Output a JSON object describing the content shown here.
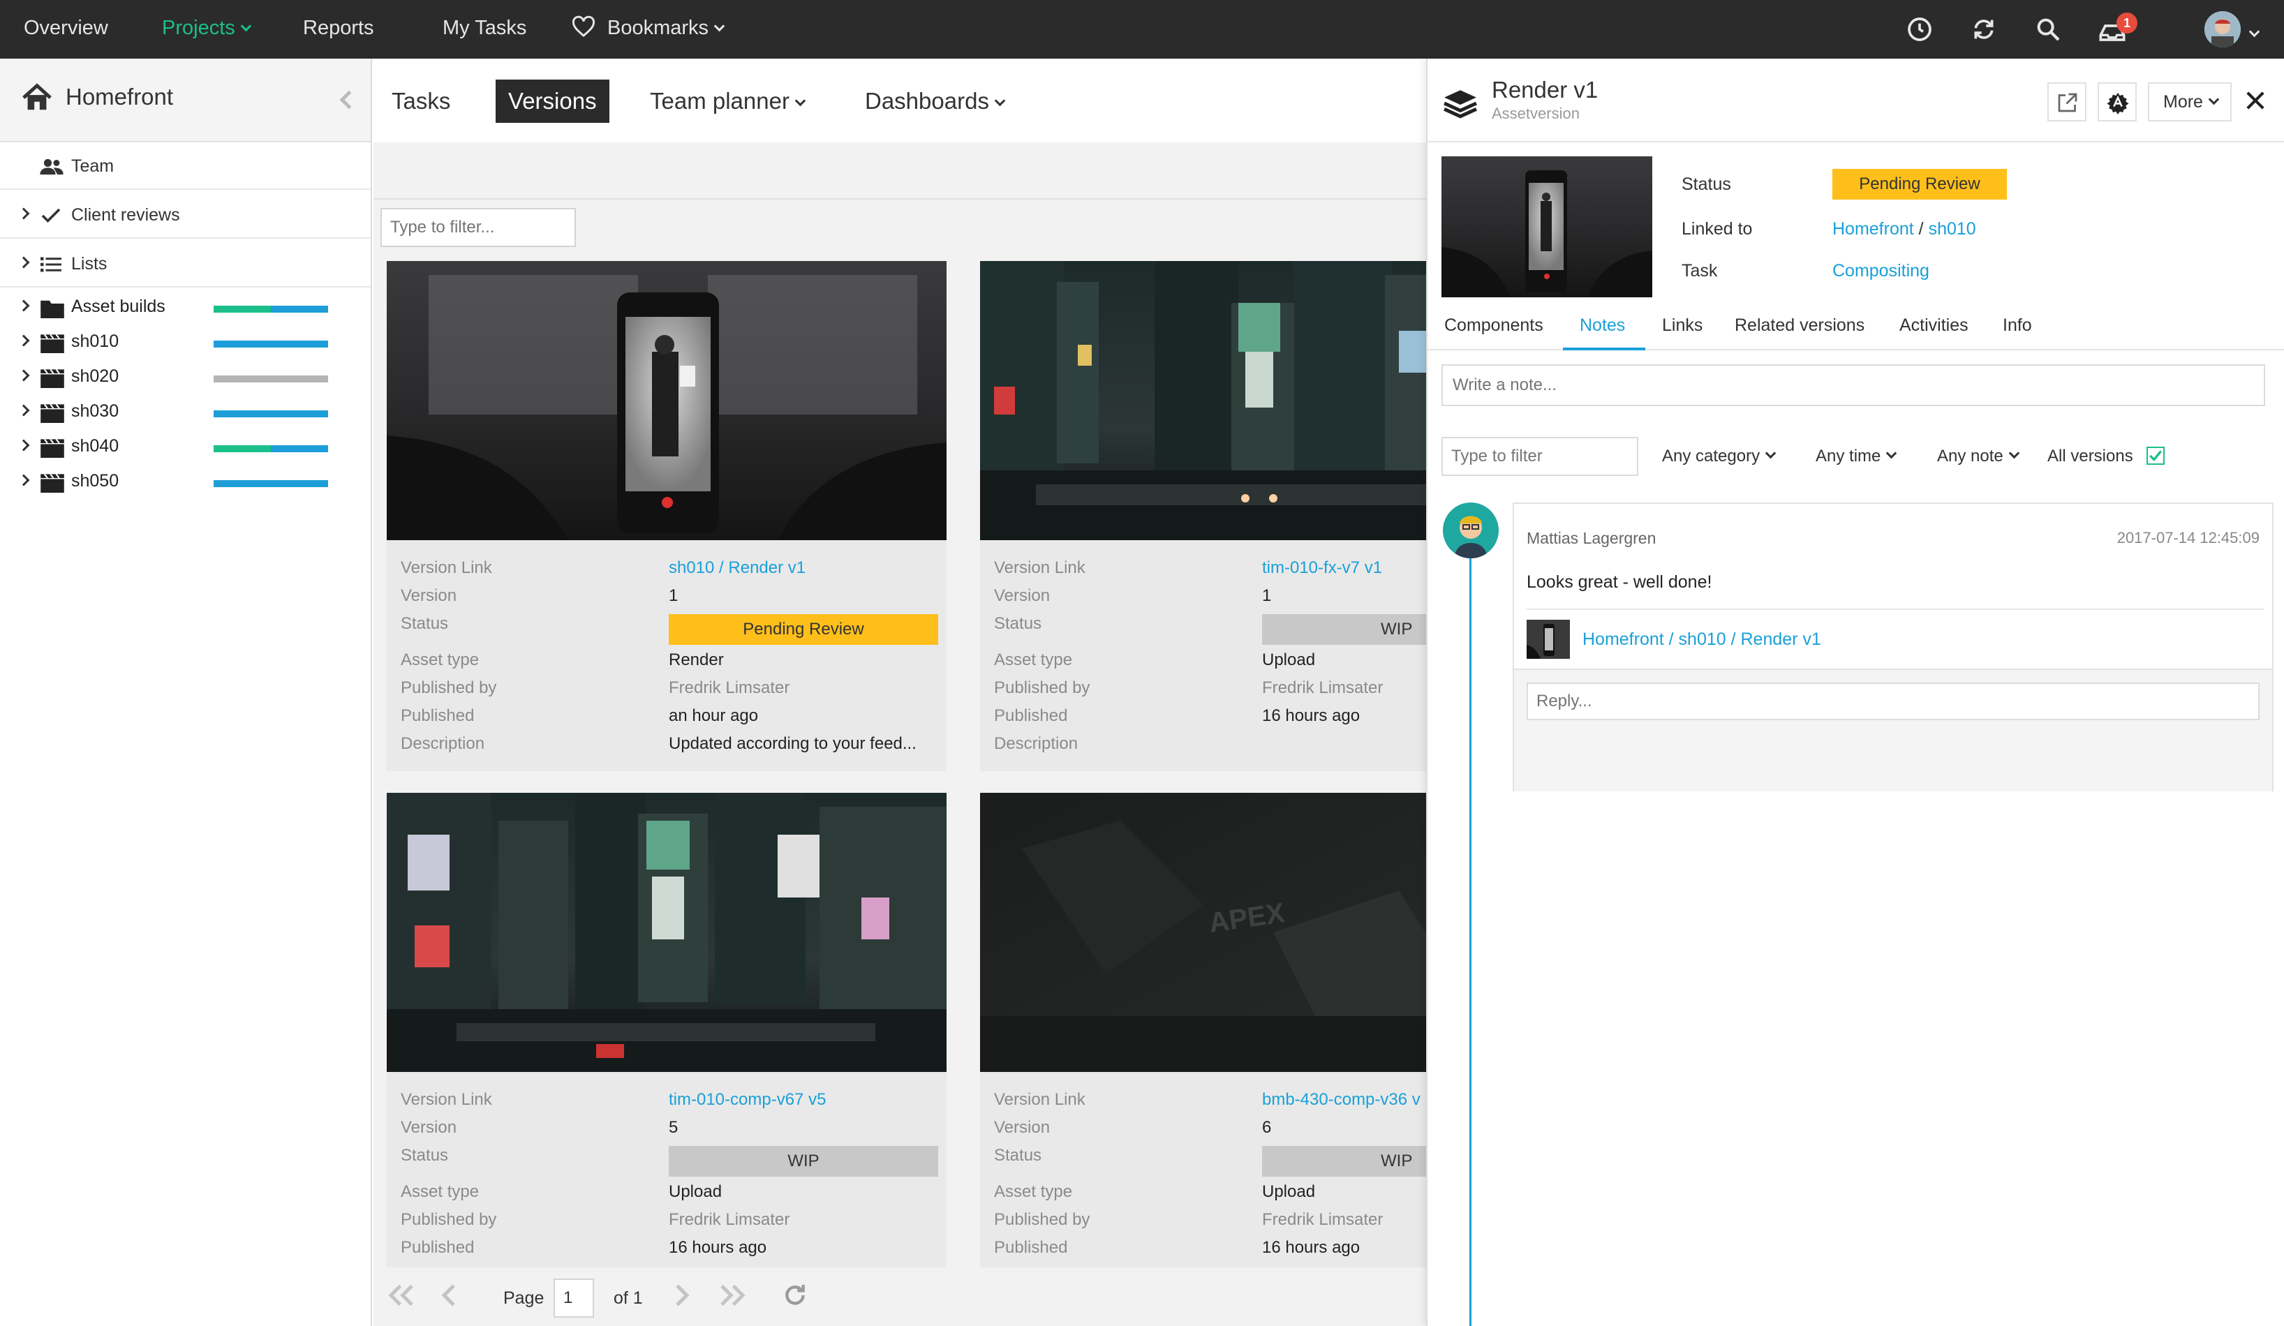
{
  "topnav": {
    "items": [
      {
        "label": "Overview"
      },
      {
        "label": "Projects",
        "active": true
      },
      {
        "label": "Reports"
      },
      {
        "label": "My Tasks"
      },
      {
        "label": "Bookmarks"
      }
    ],
    "notification_count": "1",
    "icons": [
      "clock-icon",
      "sync-icon",
      "search-icon",
      "inbox-icon",
      "avatar"
    ]
  },
  "sidebar": {
    "project": "Homefront",
    "sections": [
      {
        "label": "Team"
      },
      {
        "label": "Client reviews"
      },
      {
        "label": "Lists"
      }
    ],
    "tree": [
      {
        "label": "Asset builds",
        "icon": "folder-icon",
        "progress_green": 0.5
      },
      {
        "label": "sh010",
        "icon": "clapper-icon",
        "progress_green": 0
      },
      {
        "label": "sh020",
        "icon": "clapper-icon",
        "progress_green": 0,
        "color": "#b5b5b5"
      },
      {
        "label": "sh030",
        "icon": "clapper-icon",
        "progress_green": 0
      },
      {
        "label": "sh040",
        "icon": "clapper-icon",
        "progress_green": 0.5
      },
      {
        "label": "sh050",
        "icon": "clapper-icon",
        "progress_green": 0
      }
    ]
  },
  "main": {
    "tabs": [
      {
        "label": "Tasks"
      },
      {
        "label": "Versions",
        "active": true
      },
      {
        "label": "Team planner"
      },
      {
        "label": "Dashboards"
      }
    ],
    "filter_placeholder": "Type to filter...",
    "field_labels": {
      "version_link": "Version Link",
      "version": "Version",
      "status": "Status",
      "asset_type": "Asset type",
      "published_by": "Published by",
      "published": "Published",
      "description": "Description"
    },
    "cards": [
      {
        "version_link": "sh010 / Render v1",
        "version": "1",
        "status": "Pending Review",
        "asset_type": "Render",
        "published_by": "Fredrik Limsater",
        "published": "an hour ago",
        "description": "Updated according to your feed..."
      },
      {
        "version_link": "tim-010-fx-v7 v1",
        "version": "1",
        "status": "WIP",
        "asset_type": "Upload",
        "published_by": "Fredrik Limsater",
        "published": "16 hours ago",
        "description": ""
      },
      {
        "version_link": "tim-010-comp-v67 v5",
        "version": "5",
        "status": "WIP",
        "asset_type": "Upload",
        "published_by": "Fredrik Limsater",
        "published": "16 hours ago"
      },
      {
        "version_link": "bmb-430-comp-v36 v",
        "version": "6",
        "status": "WIP",
        "asset_type": "Upload",
        "published_by": "Fredrik Limsater",
        "published": "16 hours ago"
      }
    ],
    "pager": {
      "page_label": "Page",
      "page": "1",
      "of": "of 1"
    }
  },
  "panel": {
    "title": "Render v1",
    "subtitle": "Assetversion",
    "more_label": "More",
    "meta": {
      "status_label": "Status",
      "status": "Pending Review",
      "linked_label": "Linked to",
      "linked_project": "Homefront",
      "linked_sep": "/",
      "linked_shot": "sh010",
      "task_label": "Task",
      "task": "Compositing"
    },
    "tabs": [
      {
        "label": "Components"
      },
      {
        "label": "Notes",
        "active": true
      },
      {
        "label": "Links"
      },
      {
        "label": "Related versions"
      },
      {
        "label": "Activities"
      },
      {
        "label": "Info"
      }
    ],
    "note_placeholder": "Write a note...",
    "filter_placeholder": "Type to filter",
    "filters": [
      {
        "label": "Any category"
      },
      {
        "label": "Any time"
      },
      {
        "label": "Any note"
      }
    ],
    "all_versions_label": "All versions",
    "all_versions_checked": true,
    "note": {
      "author": "Mattias Lagergren",
      "date": "2017-07-14 12:45:09",
      "text": "Looks great - well done!",
      "link": "Homefront / sh010 / Render v1",
      "reply_placeholder": "Reply..."
    }
  },
  "colors": {
    "accent_green": "#1bbf8a",
    "link_blue": "#1aa0d8",
    "pending": "#ffbf1a",
    "wip": "#c8c8c8",
    "nav_bg": "#2b2b2b"
  }
}
